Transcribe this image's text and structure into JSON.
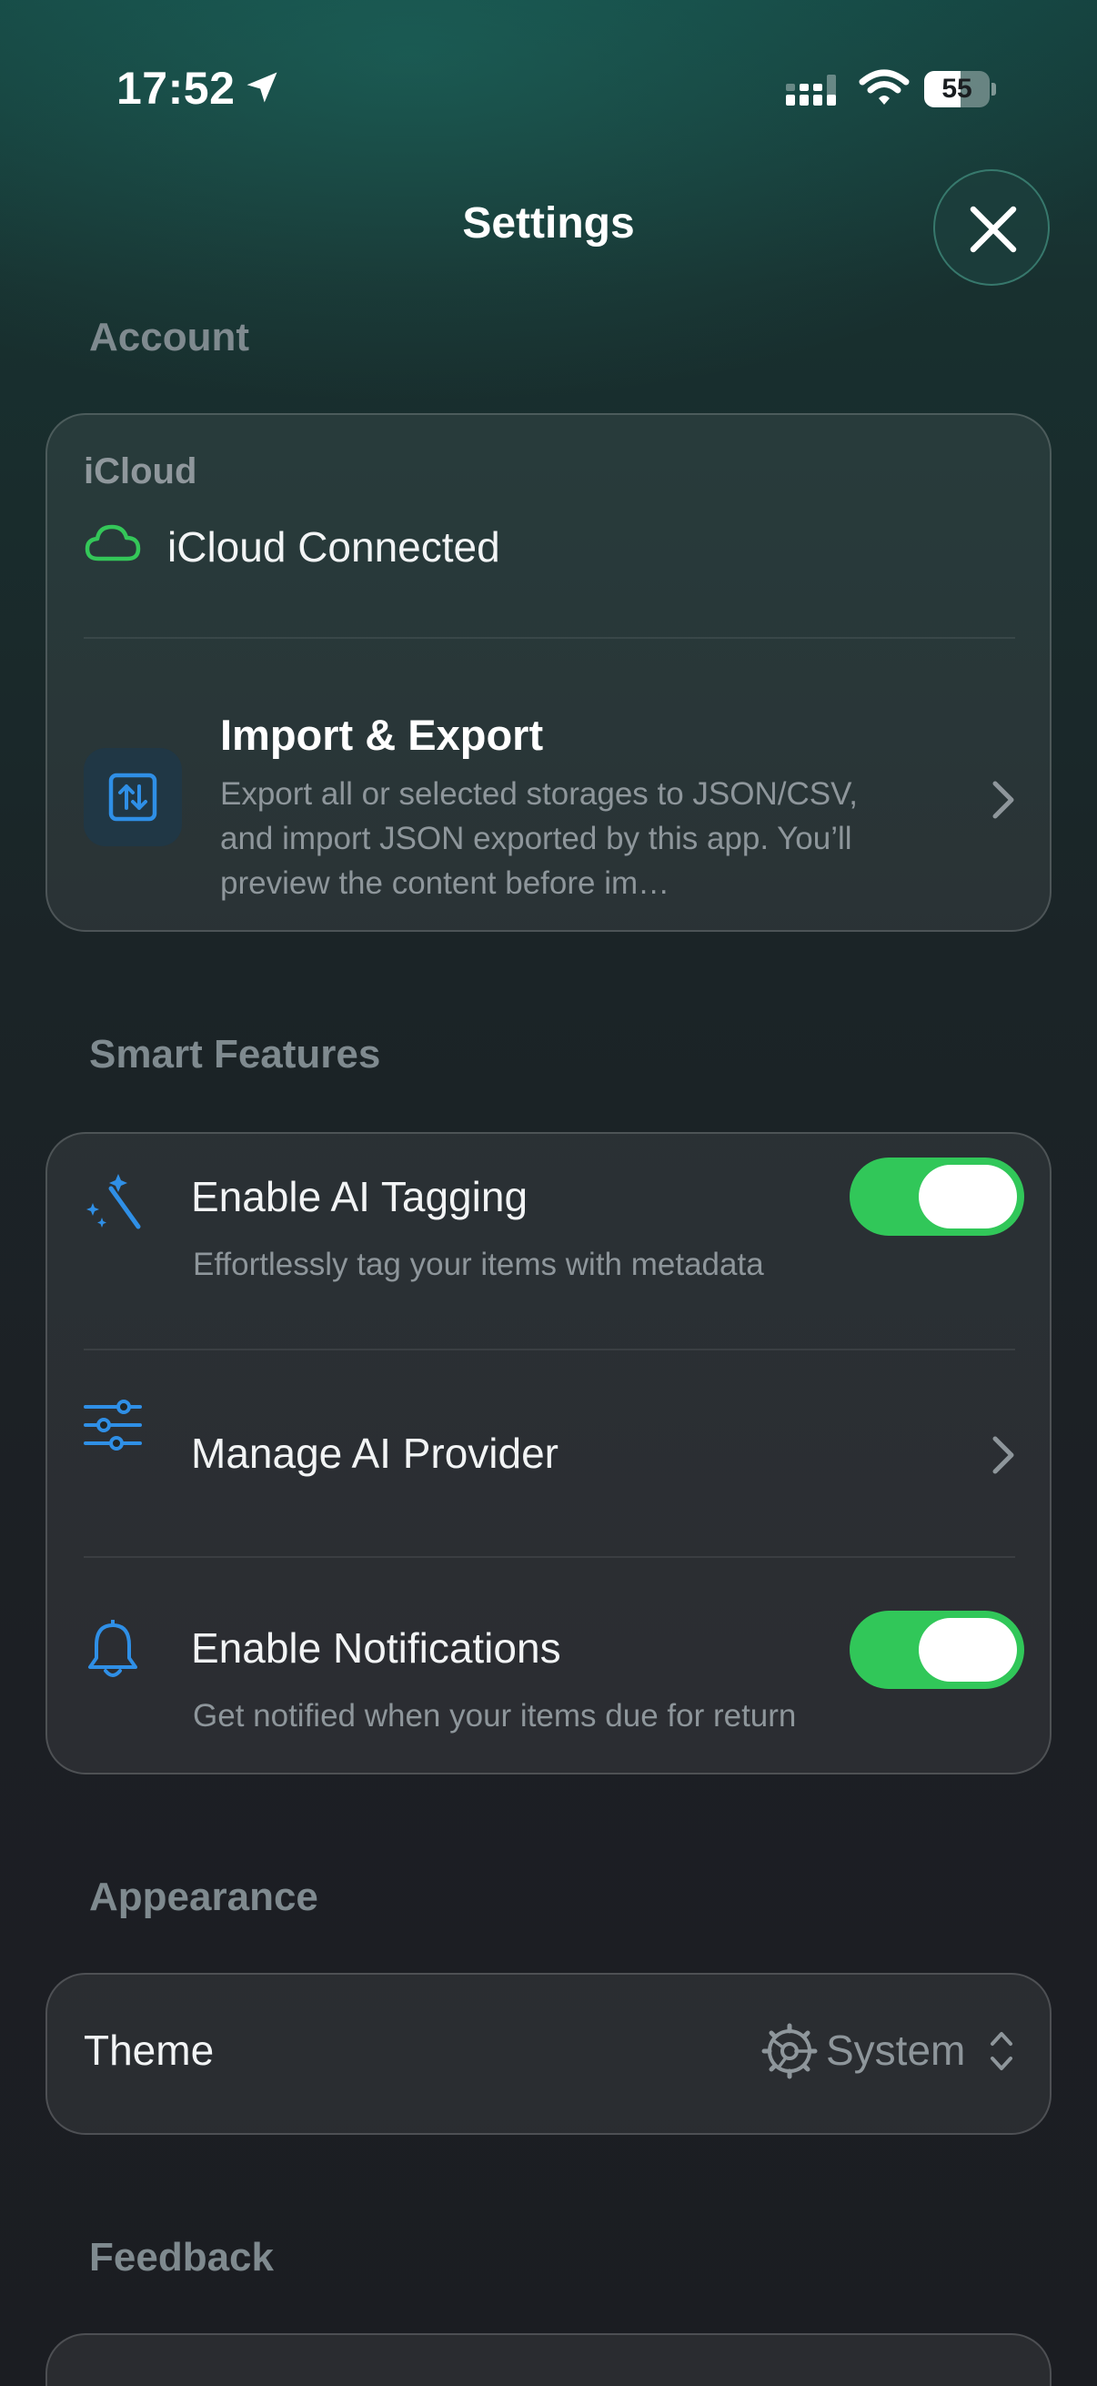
{
  "status_bar": {
    "time": "17:52",
    "battery": "55",
    "battery_level": 0.55,
    "icons": [
      "location-arrow-icon",
      "cellular-signal-icon",
      "wifi-icon",
      "battery-icon"
    ]
  },
  "header": {
    "title": "Settings",
    "close_icon": "xmark-icon"
  },
  "sections": {
    "account": {
      "header": "Account",
      "icloud_label": "iCloud",
      "icloud_status": "iCloud Connected",
      "icloud_icon": "cloud-icon",
      "import_export": {
        "title": "Import & Export",
        "description": "Export all or selected storages to JSON/CSV, and import JSON exported by this app. You’ll preview the content before im…",
        "icon": "arrow-up-down-square-icon"
      }
    },
    "smart_features": {
      "header": "Smart Features",
      "ai_tagging": {
        "title": "Enable AI Tagging",
        "subtitle": "Effortlessly tag your items with metadata",
        "enabled": true,
        "icon": "magic-wand-icon"
      },
      "ai_provider": {
        "title": "Manage AI Provider",
        "icon": "sliders-icon"
      },
      "notifications": {
        "title": "Enable Notifications",
        "subtitle": "Get notified when your items due for return",
        "enabled": true,
        "icon": "bell-icon"
      }
    },
    "appearance": {
      "header": "Appearance",
      "theme_label": "Theme",
      "theme_value": "System",
      "theme_icon": "gear-icon"
    },
    "feedback": {
      "header": "Feedback"
    }
  },
  "colors": {
    "accent_blue": "#2f8fe6",
    "toggle_green": "#31c759",
    "cloud_green": "#34c759",
    "section_header": "#7f8a8f"
  }
}
